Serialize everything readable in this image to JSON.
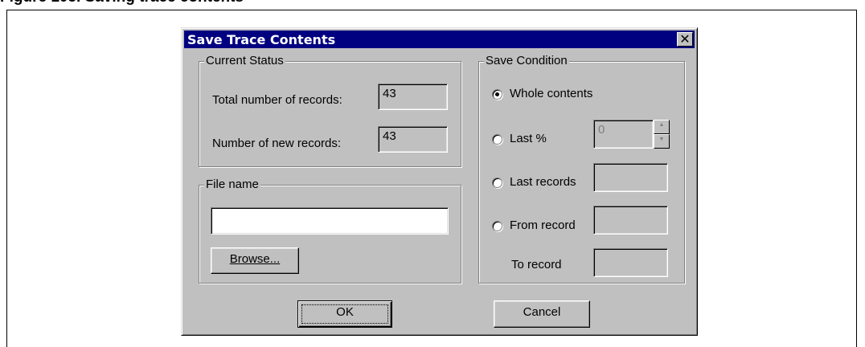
{
  "figure_caption": "Figure 105. Saving trace contents",
  "dialog": {
    "title": "Save Trace Contents",
    "close_glyph": "✕"
  },
  "current_status": {
    "group_label": "Current Status",
    "total_label": "Total number of records:",
    "total_value": "43",
    "new_label": "Number of new records:",
    "new_value": "43"
  },
  "file_name": {
    "group_label": "File name",
    "value": "",
    "browse_label": "Browse..."
  },
  "save_condition": {
    "group_label": "Save Condition",
    "options": [
      {
        "label": "Whole contents",
        "selected": true
      },
      {
        "label": "Last %",
        "selected": false
      },
      {
        "label": "Last records",
        "selected": false
      },
      {
        "label": "From record",
        "selected": false
      }
    ],
    "last_percent_value": "0",
    "to_record_label": "To record"
  },
  "buttons": {
    "ok_label": "OK",
    "cancel_label": "Cancel"
  }
}
